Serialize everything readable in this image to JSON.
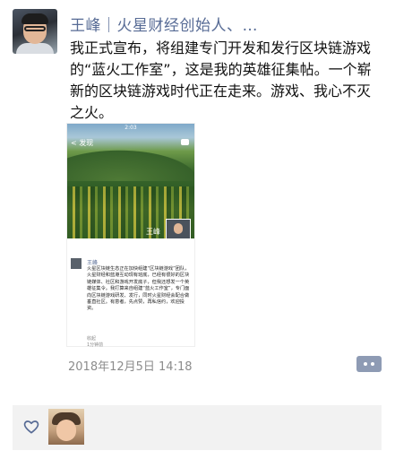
{
  "post": {
    "author": "王峰｜火星财经创始人、…",
    "text": "我正式宣布，将组建专门开发和发行区块链游戏的“蓝火工作室”，这是我的英雄征集帖。一个崭新的区块链游戏时代正在走来。游戏、我心不灭之火。",
    "timestamp": "2018年12月5日 14:18"
  },
  "shared_image": {
    "status_time": "2:03",
    "back_label": "< 发现",
    "profile_name": "王峰",
    "inner_post": {
      "author": "王峰",
      "text": "火星区块链生态正在加快组建“区块链游戏”团队，火星财经和蓝港互动现有班底，已经有很好的区块链媒体、社区和游戏开发底子，但我还想发一个英雄征集令。我打算来自组建“蓝火工作室”，专门面向区块链游戏研发、发行，同时火星财经会配合做垂直社区。有意者，先点赞，再私信约，欢迎投资。",
      "collapse_label": "收起",
      "time_label": "1分钟前"
    }
  },
  "icons": {
    "more": "more-dots-icon",
    "like": "heart-outline-icon"
  },
  "colors": {
    "link_blue": "#576b95",
    "more_button": "#8e9bb4",
    "likes_bg": "#f2f2f2"
  }
}
